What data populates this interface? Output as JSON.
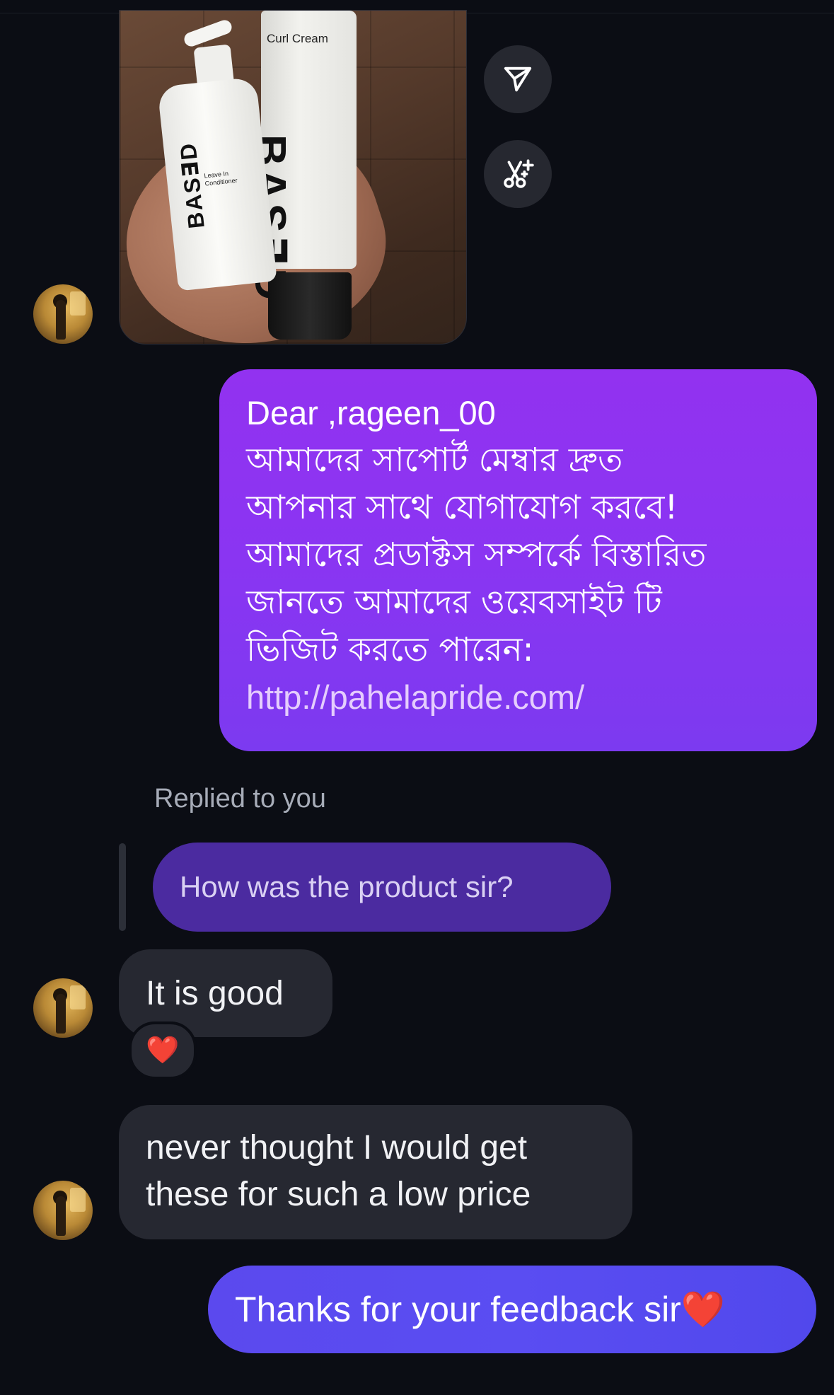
{
  "photo": {
    "tube_name": "Curl Cream",
    "tube_brand": "BAS∃D",
    "bottle_brand": "BAS∃D",
    "bottle_label": "Leave In Conditioner"
  },
  "actions": {
    "share_icon": "send-icon",
    "ai_icon": "scissors-sparkle-icon"
  },
  "messages": {
    "outgoing_1": {
      "line1": "Dear ,rageen_00",
      "line2": "আমাদের সাপোর্ট মেম্বার দ্রুত",
      "line3": "আপনার সাথে যোগাযোগ করবে!",
      "line4": "আমাদের প্রডাক্টস সম্পর্কে বিস্তারিত",
      "line5": "জানতে আমাদের ওয়েবসাইট টি",
      "line6": "ভিজিট করতে পারেন:",
      "link": "http://pahelapride.com/"
    },
    "replied_label": "Replied to you",
    "replied_quote": "How was the product sir?",
    "incoming_1": "It is good",
    "reaction_1": "❤️",
    "incoming_2_line1": "never thought I would get",
    "incoming_2_line2": "these for such a low price",
    "outgoing_2": "Thanks for your feedback sir❤️"
  },
  "colors": {
    "background": "#0b0d14",
    "outgoing_purple": "#8a35f2",
    "outgoing_blue": "#5a4df2",
    "incoming_gray": "#262831",
    "reply_quote": "#4b2ba0"
  }
}
